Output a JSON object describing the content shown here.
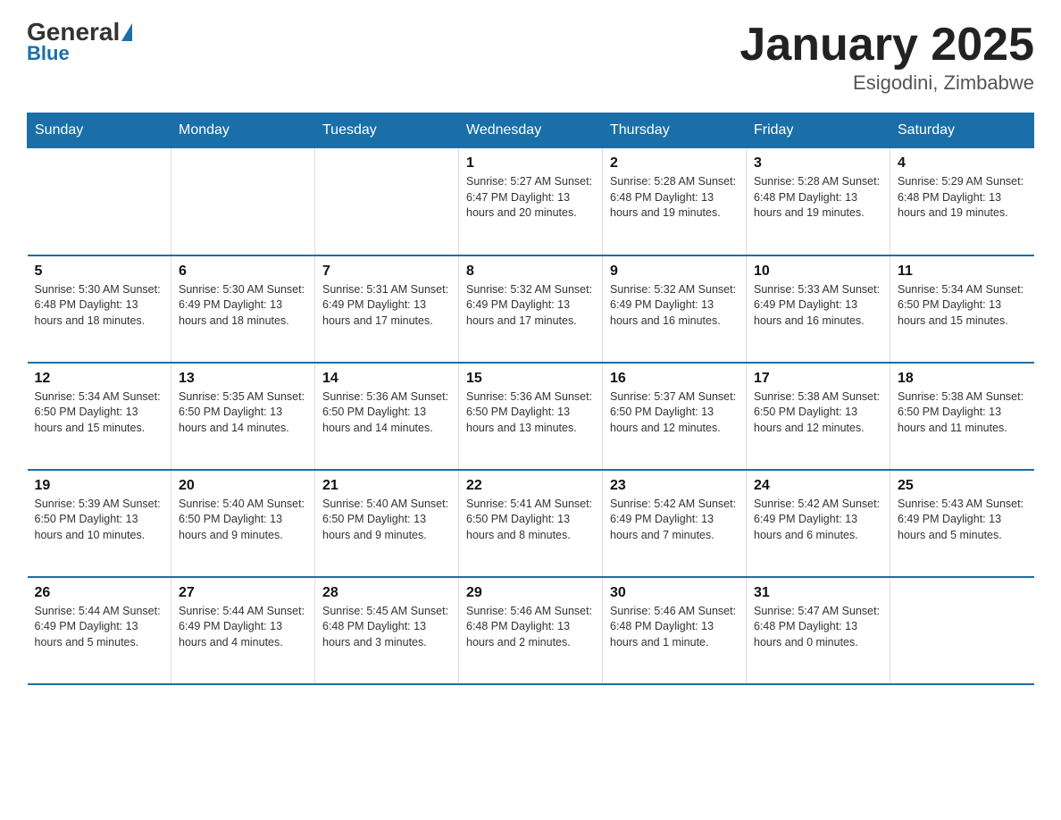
{
  "header": {
    "logo_general": "General",
    "logo_blue": "Blue",
    "month_title": "January 2025",
    "location": "Esigodini, Zimbabwe"
  },
  "days_of_week": [
    "Sunday",
    "Monday",
    "Tuesday",
    "Wednesday",
    "Thursday",
    "Friday",
    "Saturday"
  ],
  "weeks": [
    [
      {
        "day": "",
        "info": ""
      },
      {
        "day": "",
        "info": ""
      },
      {
        "day": "",
        "info": ""
      },
      {
        "day": "1",
        "info": "Sunrise: 5:27 AM\nSunset: 6:47 PM\nDaylight: 13 hours and 20 minutes."
      },
      {
        "day": "2",
        "info": "Sunrise: 5:28 AM\nSunset: 6:48 PM\nDaylight: 13 hours and 19 minutes."
      },
      {
        "day": "3",
        "info": "Sunrise: 5:28 AM\nSunset: 6:48 PM\nDaylight: 13 hours and 19 minutes."
      },
      {
        "day": "4",
        "info": "Sunrise: 5:29 AM\nSunset: 6:48 PM\nDaylight: 13 hours and 19 minutes."
      }
    ],
    [
      {
        "day": "5",
        "info": "Sunrise: 5:30 AM\nSunset: 6:48 PM\nDaylight: 13 hours and 18 minutes."
      },
      {
        "day": "6",
        "info": "Sunrise: 5:30 AM\nSunset: 6:49 PM\nDaylight: 13 hours and 18 minutes."
      },
      {
        "day": "7",
        "info": "Sunrise: 5:31 AM\nSunset: 6:49 PM\nDaylight: 13 hours and 17 minutes."
      },
      {
        "day": "8",
        "info": "Sunrise: 5:32 AM\nSunset: 6:49 PM\nDaylight: 13 hours and 17 minutes."
      },
      {
        "day": "9",
        "info": "Sunrise: 5:32 AM\nSunset: 6:49 PM\nDaylight: 13 hours and 16 minutes."
      },
      {
        "day": "10",
        "info": "Sunrise: 5:33 AM\nSunset: 6:49 PM\nDaylight: 13 hours and 16 minutes."
      },
      {
        "day": "11",
        "info": "Sunrise: 5:34 AM\nSunset: 6:50 PM\nDaylight: 13 hours and 15 minutes."
      }
    ],
    [
      {
        "day": "12",
        "info": "Sunrise: 5:34 AM\nSunset: 6:50 PM\nDaylight: 13 hours and 15 minutes."
      },
      {
        "day": "13",
        "info": "Sunrise: 5:35 AM\nSunset: 6:50 PM\nDaylight: 13 hours and 14 minutes."
      },
      {
        "day": "14",
        "info": "Sunrise: 5:36 AM\nSunset: 6:50 PM\nDaylight: 13 hours and 14 minutes."
      },
      {
        "day": "15",
        "info": "Sunrise: 5:36 AM\nSunset: 6:50 PM\nDaylight: 13 hours and 13 minutes."
      },
      {
        "day": "16",
        "info": "Sunrise: 5:37 AM\nSunset: 6:50 PM\nDaylight: 13 hours and 12 minutes."
      },
      {
        "day": "17",
        "info": "Sunrise: 5:38 AM\nSunset: 6:50 PM\nDaylight: 13 hours and 12 minutes."
      },
      {
        "day": "18",
        "info": "Sunrise: 5:38 AM\nSunset: 6:50 PM\nDaylight: 13 hours and 11 minutes."
      }
    ],
    [
      {
        "day": "19",
        "info": "Sunrise: 5:39 AM\nSunset: 6:50 PM\nDaylight: 13 hours and 10 minutes."
      },
      {
        "day": "20",
        "info": "Sunrise: 5:40 AM\nSunset: 6:50 PM\nDaylight: 13 hours and 9 minutes."
      },
      {
        "day": "21",
        "info": "Sunrise: 5:40 AM\nSunset: 6:50 PM\nDaylight: 13 hours and 9 minutes."
      },
      {
        "day": "22",
        "info": "Sunrise: 5:41 AM\nSunset: 6:50 PM\nDaylight: 13 hours and 8 minutes."
      },
      {
        "day": "23",
        "info": "Sunrise: 5:42 AM\nSunset: 6:49 PM\nDaylight: 13 hours and 7 minutes."
      },
      {
        "day": "24",
        "info": "Sunrise: 5:42 AM\nSunset: 6:49 PM\nDaylight: 13 hours and 6 minutes."
      },
      {
        "day": "25",
        "info": "Sunrise: 5:43 AM\nSunset: 6:49 PM\nDaylight: 13 hours and 5 minutes."
      }
    ],
    [
      {
        "day": "26",
        "info": "Sunrise: 5:44 AM\nSunset: 6:49 PM\nDaylight: 13 hours and 5 minutes."
      },
      {
        "day": "27",
        "info": "Sunrise: 5:44 AM\nSunset: 6:49 PM\nDaylight: 13 hours and 4 minutes."
      },
      {
        "day": "28",
        "info": "Sunrise: 5:45 AM\nSunset: 6:48 PM\nDaylight: 13 hours and 3 minutes."
      },
      {
        "day": "29",
        "info": "Sunrise: 5:46 AM\nSunset: 6:48 PM\nDaylight: 13 hours and 2 minutes."
      },
      {
        "day": "30",
        "info": "Sunrise: 5:46 AM\nSunset: 6:48 PM\nDaylight: 13 hours and 1 minute."
      },
      {
        "day": "31",
        "info": "Sunrise: 5:47 AM\nSunset: 6:48 PM\nDaylight: 13 hours and 0 minutes."
      },
      {
        "day": "",
        "info": ""
      }
    ]
  ]
}
